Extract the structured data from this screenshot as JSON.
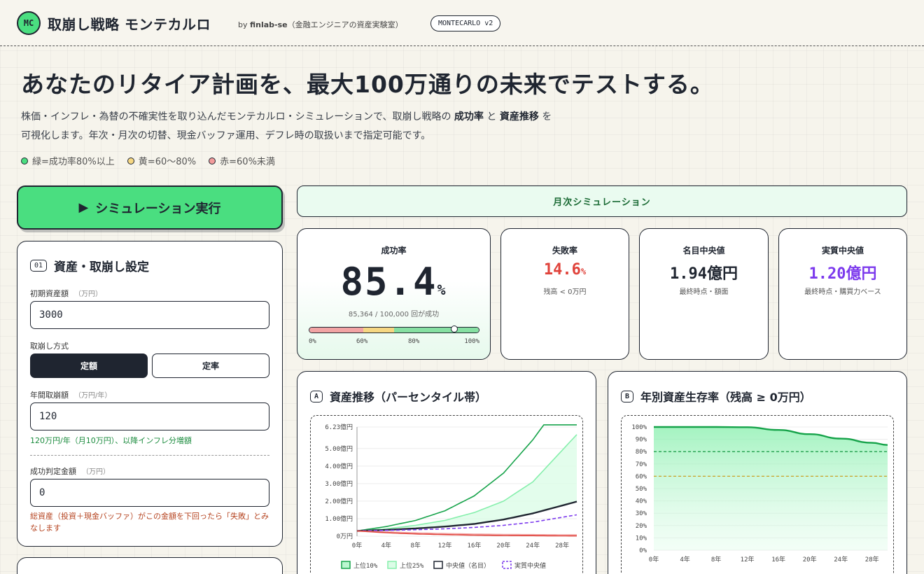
{
  "header": {
    "logo": "MC",
    "title": "取崩し戦略 モンテカルロ",
    "by_prefix": "by ",
    "by_author": "finlab-se",
    "by_suffix": "（金融エンジニアの資産実験室）",
    "version": "MONTECARLO v2"
  },
  "hero": {
    "title": "あなたのリタイア計画を、最大100万通りの未来でテストする。",
    "desc_part1": "株価・インフレ・為替の不確実性を取り込んだモンテカルロ・シミュレーションで、取崩し戦略の ",
    "desc_bold1": "成功率",
    "desc_mid": " と ",
    "desc_bold2": "資産推移",
    "desc_part2": " を",
    "desc_line2": "可視化します。年次・月次の切替、現金バッファ運用、デフレ時の取扱いまで指定可能です。",
    "legend": [
      {
        "label": "緑=成功率80%以上",
        "color": "#4ade80"
      },
      {
        "label": "黄=60〜80%",
        "color": "#f6d782"
      },
      {
        "label": "赤=60%未満",
        "color": "#f29b9b"
      }
    ]
  },
  "run_button": {
    "label": "シミュレーション実行",
    "icon": "play-icon"
  },
  "settings": {
    "num": "01",
    "title": "資産・取崩し設定",
    "initial_label": "初期資産額",
    "initial_unit": "（万円）",
    "initial_value": "3000",
    "method_label": "取崩し方式",
    "method_fixed": "定額",
    "method_rate": "定率",
    "annual_label": "年間取崩額",
    "annual_unit": "（万円/年）",
    "annual_value": "120",
    "annual_hint": "120万円/年（月10万円）、以降インフレ分増額",
    "threshold_label": "成功判定金額",
    "threshold_unit": "（万円）",
    "threshold_value": "0",
    "threshold_hint": "総資産（投資＋現金バッファ）がこの金額を下回ったら「失敗」とみなします"
  },
  "mode_bar": {
    "label": "月次シミュレーション"
  },
  "stats": {
    "success": {
      "label": "成功率",
      "value": "85.4",
      "unit": "%",
      "value_fraction": 0.854,
      "sub": "85,364 / 100,000 回が成功",
      "ticks": [
        "0%",
        "60%",
        "80%",
        "100%"
      ]
    },
    "failure": {
      "label": "失敗率",
      "value": "14.6",
      "unit": "%",
      "note": "残高 < 0万円",
      "color": "#e0433b"
    },
    "nominal": {
      "label": "名目中央値",
      "value": "1.94億円",
      "note": "最終時点・額面"
    },
    "real": {
      "label": "実質中央値",
      "value": "1.20億円",
      "note": "最終時点・購買力ベース",
      "color": "#7c3aed"
    }
  },
  "chart_a": {
    "badge": "A",
    "title": "資産推移（パーセンタイル帯）"
  },
  "chart_b": {
    "badge": "B",
    "title": "年別資産生存率（残高 ≥ 0万円）"
  },
  "chart_data": [
    {
      "type": "line",
      "title": "資産推移（パーセンタイル帯）",
      "x": [
        0,
        4,
        8,
        12,
        16,
        20,
        24,
        28
      ],
      "x_tick_labels": [
        "0年",
        "4年",
        "8年",
        "12年",
        "16年",
        "20年",
        "24年",
        "28年"
      ],
      "y_tick_labels": [
        "0万円",
        "1.00億円",
        "2.00億円",
        "3.00億円",
        "4.00億円",
        "5.00億円",
        "6.23億円"
      ],
      "ylim": [
        0,
        6.23
      ],
      "y_unit": "億円",
      "grid": true,
      "legend": "bottom",
      "series": [
        {
          "name": "上位10%",
          "color": "#16a34a",
          "values": [
            0.3,
            0.55,
            0.9,
            1.45,
            2.3,
            3.6,
            5.5,
            7.8
          ]
        },
        {
          "name": "上位25%",
          "color": "#86efac",
          "values": [
            0.3,
            0.42,
            0.62,
            0.9,
            1.35,
            2.0,
            3.1,
            4.9
          ]
        },
        {
          "name": "中央値（名目）",
          "color": "#1f2530",
          "values": [
            0.3,
            0.36,
            0.44,
            0.55,
            0.7,
            0.95,
            1.3,
            1.75
          ]
        },
        {
          "name": "実質中央値",
          "color": "#7c3aed",
          "dashed": true,
          "values": [
            0.3,
            0.33,
            0.37,
            0.42,
            0.5,
            0.62,
            0.8,
            1.08
          ]
        },
        {
          "name": "",
          "color": "#f2a4a4",
          "values": [
            0.3,
            0.24,
            0.19,
            0.15,
            0.12,
            0.1,
            0.09,
            0.08
          ]
        },
        {
          "name": "",
          "color": "#e0433b",
          "values": [
            0.3,
            0.2,
            0.13,
            0.09,
            0.06,
            0.04,
            0.03,
            0.02
          ]
        }
      ]
    },
    {
      "type": "area",
      "title": "年別資産生存率（残高 ≥ 0万円）",
      "x": [
        0,
        4,
        8,
        12,
        16,
        20,
        24,
        28,
        30
      ],
      "x_tick_labels": [
        "0年",
        "4年",
        "8年",
        "12年",
        "16年",
        "20年",
        "24年",
        "28年"
      ],
      "y_tick_labels": [
        "0%",
        "10%",
        "20%",
        "30%",
        "40%",
        "50%",
        "60%",
        "70%",
        "80%",
        "90%",
        "100%"
      ],
      "ylim": [
        0,
        100
      ],
      "grid": true,
      "thresholds": [
        {
          "value": 80,
          "color": "#22a04e"
        },
        {
          "value": 60,
          "color": "#c9a227"
        }
      ],
      "series": [
        {
          "name": "",
          "color": "#16a34a",
          "values": [
            100,
            100,
            100,
            99.8,
            97.6,
            94.2,
            90.6,
            87.2,
            85.4
          ]
        }
      ]
    }
  ]
}
